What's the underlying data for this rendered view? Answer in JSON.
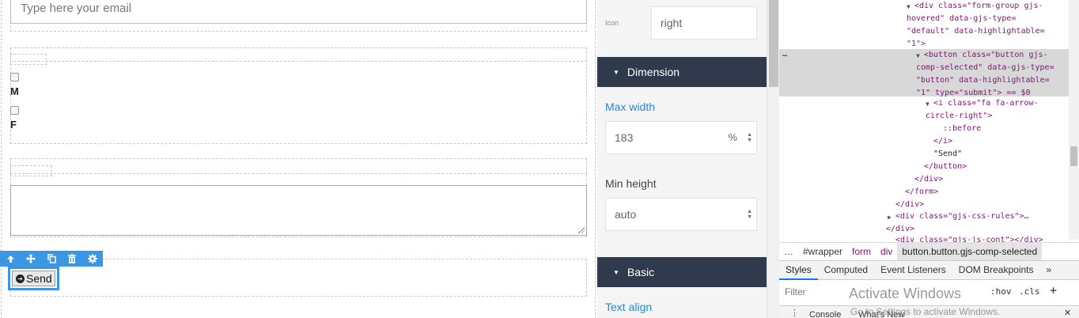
{
  "canvas": {
    "email_placeholder": "Type here your email",
    "checkbox_labels": [
      "M",
      "F"
    ],
    "toolbar_icons": [
      "arrow-up-icon",
      "move-icon",
      "clone-icon",
      "trash-icon",
      "gear-icon"
    ],
    "send_label": "Send"
  },
  "style_manager": {
    "icon_label": "Icon",
    "icon_value": "right",
    "dimension_title": "Dimension",
    "max_width_label": "Max width",
    "max_width_value": "183",
    "max_width_unit": "%",
    "min_height_label": "Min height",
    "min_height_value": "auto",
    "basic_title": "Basic",
    "text_align_label": "Text align",
    "accent_color": "#2a86d6",
    "section_color": "#2f3b4c"
  },
  "devtools": {
    "dom": {
      "l1": "<div class=\"form-group gjs-",
      "l2": "hovered\" data-gjs-type=",
      "l3": "\"default\" data-highlightable=",
      "l4": "\"1\">",
      "l5": "<button class=\"button gjs-",
      "l6": "comp-selected\" data-gjs-type=",
      "l7": "\"button\" data-highlightable=",
      "l8": "\"1\" type=\"submit\"> == $0",
      "l9": "<i class=\"fa fa-arrow-",
      "l10": "circle-right\">",
      "l11": "::before",
      "l12": "</i>",
      "l13": "\"Send\"",
      "l14": "</button>",
      "l15": "</div>",
      "l16": "</form>",
      "l17": "</div>",
      "l18": "<div class=\"gjs-css-rules\">…",
      "l19": "</div>",
      "l20": "<div class=\"gjs-js-cont\"></div>"
    },
    "dots": "…",
    "breadcrumbs": [
      "…",
      "#wrapper",
      "form",
      "div",
      "button.button.gjs-comp-selected"
    ],
    "tabs": [
      "Styles",
      "Computed",
      "Event Listeners",
      "DOM Breakpoints",
      "»"
    ],
    "filter_placeholder": "Filter",
    "hov": ":hov",
    "cls": ".cls",
    "plus": "+",
    "drawer_tabs": [
      "Console",
      "What's New"
    ],
    "close": "✕"
  },
  "watermark": {
    "title": "Activate Windows",
    "subtitle": "Go to Settings to activate Windows."
  }
}
